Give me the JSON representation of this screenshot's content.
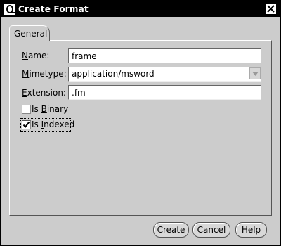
{
  "window": {
    "title": "Create Format",
    "title_icon": "oracle-icon",
    "close_icon": "close-icon"
  },
  "tabs": [
    {
      "label": "General",
      "selected": true
    }
  ],
  "form": {
    "name": {
      "label_mn": "N",
      "label_rest": "ame:",
      "value": "frame"
    },
    "mimetype": {
      "label_mn": "M",
      "label_rest": "imetype:",
      "value": "application/msword"
    },
    "extension": {
      "label_mn": "E",
      "label_rest": "xtension:",
      "value": ".fm"
    },
    "is_binary": {
      "label_pre": "Is ",
      "label_mn": "B",
      "label_rest": "inary",
      "checked": false
    },
    "is_indexed": {
      "label_pre": "Is ",
      "label_mn": "I",
      "label_rest": "ndexed",
      "checked": true
    }
  },
  "buttons": {
    "create": "Create",
    "cancel": "Cancel",
    "help": "Help"
  }
}
